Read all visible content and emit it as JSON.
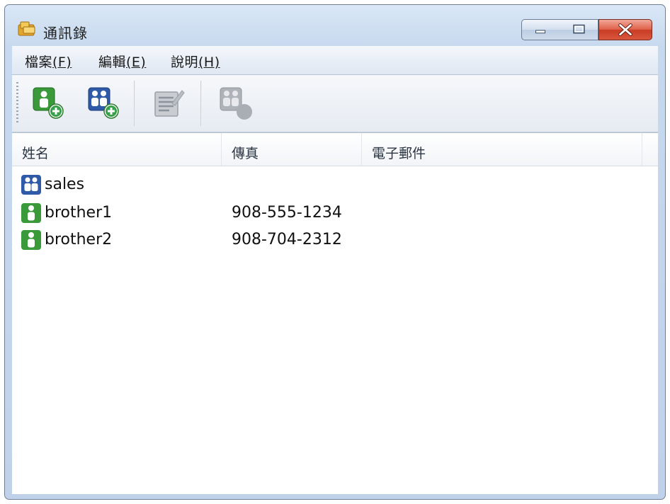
{
  "window": {
    "title": "通訊錄",
    "app_icon": "address-book-icon"
  },
  "window_controls": {
    "minimize_icon": "minimize-icon",
    "maximize_icon": "maximize-icon",
    "close_icon": "close-icon"
  },
  "menubar": {
    "items": [
      {
        "label": "檔案",
        "accel": "(F)"
      },
      {
        "label": "編輯",
        "accel": "(E)"
      },
      {
        "label": "說明",
        "accel": "(H)"
      }
    ]
  },
  "toolbar": {
    "buttons": [
      {
        "icon": "add-contact-icon",
        "enabled": true
      },
      {
        "icon": "add-group-icon",
        "enabled": true
      },
      {
        "icon": "edit-icon",
        "enabled": false
      },
      {
        "icon": "delete-icon",
        "enabled": false
      }
    ]
  },
  "list": {
    "columns": [
      "姓名",
      "傳真",
      "電子郵件"
    ],
    "rows": [
      {
        "type": "group",
        "icon": "group-icon",
        "name": "sales",
        "fax": "",
        "email": ""
      },
      {
        "type": "contact",
        "icon": "contact-icon",
        "name": "brother1",
        "fax": "908-555-1234",
        "email": ""
      },
      {
        "type": "contact",
        "icon": "contact-icon",
        "name": "brother2",
        "fax": "908-704-2312",
        "email": ""
      }
    ]
  },
  "colors": {
    "contact_green": "#3a9a3a",
    "group_blue": "#2f5aa8",
    "close_red": "#d24c33"
  }
}
